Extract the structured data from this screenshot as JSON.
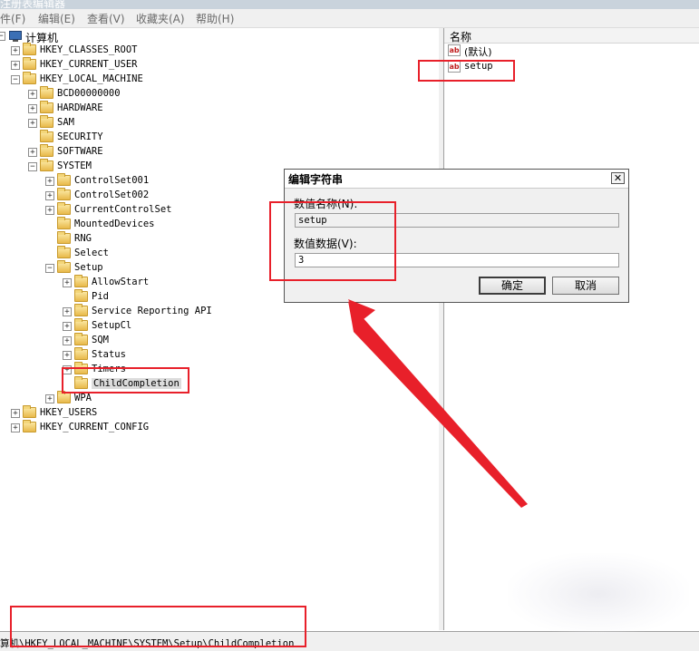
{
  "window": {
    "title": "注册表编辑器"
  },
  "menu": [
    {
      "label": "件(F)"
    },
    {
      "label": "编辑(E)"
    },
    {
      "label": "查看(V)"
    },
    {
      "label": "收藏夹(A)"
    },
    {
      "label": "帮助(H)"
    }
  ],
  "tree": {
    "root": "计算机",
    "hkcr": "HKEY_CLASSES_ROOT",
    "hkcu": "HKEY_CURRENT_USER",
    "hklm": "HKEY_LOCAL_MACHINE",
    "bcd": "BCD00000000",
    "hardware": "HARDWARE",
    "sam": "SAM",
    "security": "SECURITY",
    "software": "SOFTWARE",
    "system": "SYSTEM",
    "cs001": "ControlSet001",
    "cs002": "ControlSet002",
    "ccs": "CurrentControlSet",
    "mounted": "MountedDevices",
    "rng": "RNG",
    "select": "Select",
    "setup": "Setup",
    "allowstart": "AllowStart",
    "pid": "Pid",
    "sra": "Service Reporting API",
    "setupcl": "SetupCl",
    "sqm": "SQM",
    "status": "Status",
    "timers": "Timers",
    "childcompletion": "ChildCompletion",
    "wpa": "WPA",
    "hku": "HKEY_USERS",
    "hkcc": "HKEY_CURRENT_CONFIG",
    "expand_plus": "+",
    "expand_minus": "−"
  },
  "list": {
    "header_name": "名称",
    "icon_text": "ab",
    "values": [
      {
        "name": "(默认)"
      },
      {
        "name": "setup"
      }
    ]
  },
  "status_bar": {
    "path": "算机\\HKEY_LOCAL_MACHINE\\SYSTEM\\Setup\\ChildCompletion"
  },
  "dialog": {
    "title": "编辑字符串",
    "close_glyph": "✕",
    "value_name_label": "数值名称(N):",
    "value_name": "setup",
    "value_data_label": "数值数据(V):",
    "value_data": "3",
    "ok_label": "确定",
    "cancel_label": "取消"
  },
  "colors": {
    "annotation": "#e8202a",
    "folder": "#e8b94a"
  }
}
